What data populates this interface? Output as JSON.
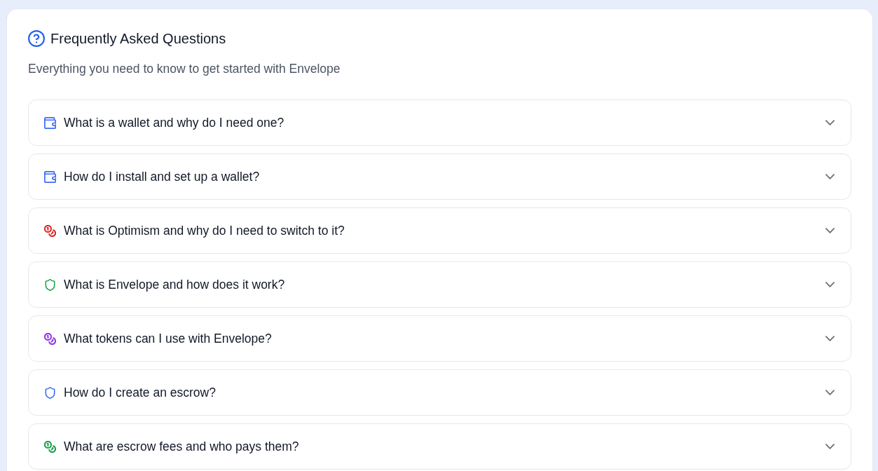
{
  "header": {
    "title": "Frequently Asked Questions",
    "subtitle": "Everything you need to know to get started with Envelope"
  },
  "faq_items": [
    {
      "kind": "wallet",
      "color": "#3b6cf5",
      "question": "What is a wallet and why do I need one?",
      "expanded": false
    },
    {
      "kind": "wallet",
      "color": "#3b6cf5",
      "question": "How do I install and set up a wallet?",
      "expanded": false
    },
    {
      "kind": "coins",
      "color": "#dc2626",
      "question": "What is Optimism and why do I need to switch to it?",
      "expanded": false
    },
    {
      "kind": "shield",
      "color": "#16a34a",
      "question": "What is Envelope and how does it work?",
      "expanded": false
    },
    {
      "kind": "coins",
      "color": "#9333ea",
      "question": "What tokens can I use with Envelope?",
      "expanded": false
    },
    {
      "kind": "shield",
      "color": "#3b6cf5",
      "question": "How do I create an escrow?",
      "expanded": false
    },
    {
      "kind": "coins",
      "color": "#16a34a",
      "question": "What are escrow fees and who pays them?",
      "expanded": false
    }
  ]
}
